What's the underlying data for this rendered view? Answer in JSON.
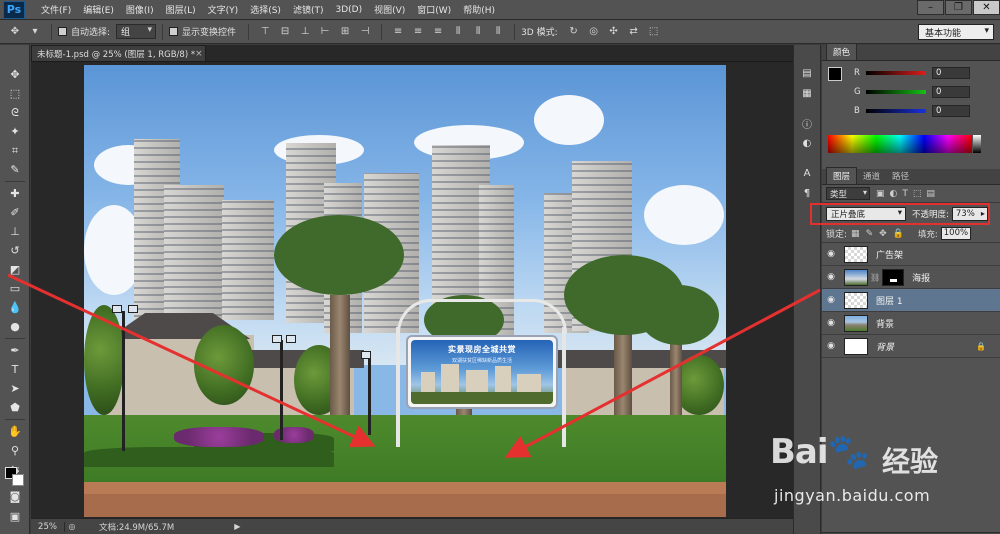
{
  "app": {
    "logo": "Ps"
  },
  "menu": [
    "文件(F)",
    "编辑(E)",
    "图像(I)",
    "图层(L)",
    "文字(Y)",
    "选择(S)",
    "滤镜(T)",
    "3D(D)",
    "视图(V)",
    "窗口(W)",
    "帮助(H)"
  ],
  "window_controls": {
    "minimize": "–",
    "restore": "❐",
    "close": "✕"
  },
  "options_bar": {
    "auto_select_label": "自动选择:",
    "auto_select_value": "组",
    "show_transform_label": "显示变换控件",
    "mode_3d_label": "3D 模式:",
    "workspace": "基本功能"
  },
  "document": {
    "tab_title": "未标题-1.psd @ 25% (图层 1, RGB/8) *",
    "tab_close": "×"
  },
  "billboard": {
    "title": "实景现房全城共赏",
    "subtitle": "双湖扶贫区稀缺新品质生活"
  },
  "status_bar": {
    "zoom": "25%",
    "doc_size": "文档:24.9M/65.7M",
    "arrow": "▶"
  },
  "color_panel": {
    "tab": "颜色",
    "channels": [
      {
        "label": "R",
        "value": "0",
        "color": "#e01c1c"
      },
      {
        "label": "G",
        "value": "0",
        "color": "#15c215"
      },
      {
        "label": "B",
        "value": "0",
        "color": "#1a32e0"
      }
    ]
  },
  "layers_panel": {
    "tabs": [
      "图层",
      "通道",
      "路径"
    ],
    "filter_kind": "类型",
    "blend_mode": "正片叠底",
    "opacity_label": "不透明度:",
    "opacity": "73%",
    "lock_label": "锁定:",
    "fill_label": "填充:",
    "fill": "100%",
    "layers": [
      {
        "name": "广告架",
        "thumb": "checker",
        "selected": false,
        "italic": false,
        "mask": false,
        "locked": false
      },
      {
        "name": "海报",
        "thumb": "poster",
        "selected": false,
        "italic": false,
        "mask": true,
        "locked": false
      },
      {
        "name": "图层 1",
        "thumb": "checker",
        "selected": true,
        "italic": false,
        "mask": false,
        "locked": false
      },
      {
        "name": "背景",
        "thumb": "photo",
        "selected": false,
        "italic": false,
        "mask": false,
        "locked": false
      },
      {
        "name": "背景",
        "thumb": "white",
        "selected": false,
        "italic": true,
        "mask": false,
        "locked": true
      }
    ]
  },
  "watermark": {
    "logo_left": "Bai",
    "logo_right": "经验",
    "url": "jingyan.baidu.com"
  },
  "colors": {
    "highlight": "#e2302e",
    "arrow": "#e53030",
    "selected_layer": "#5f7690"
  }
}
